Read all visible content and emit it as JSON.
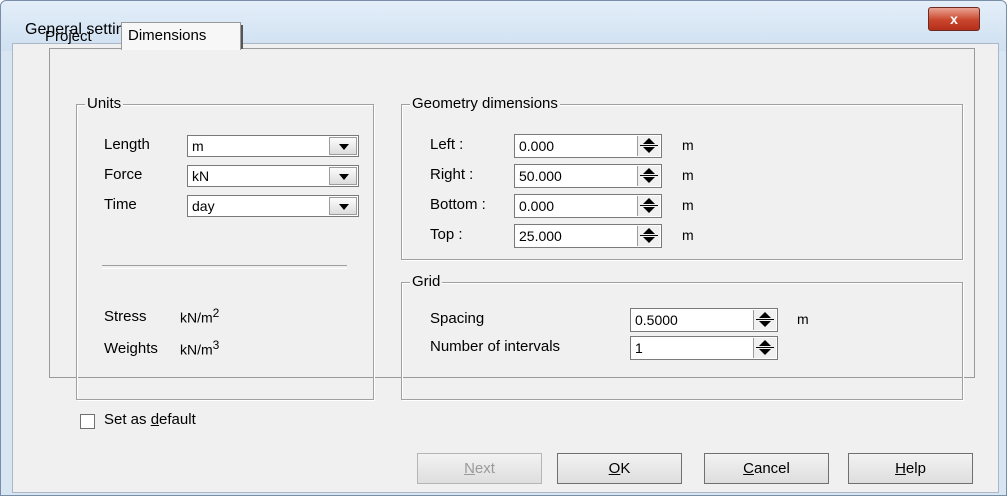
{
  "window": {
    "title": "General settings",
    "close_label": "x"
  },
  "tabs": [
    {
      "label": "Project"
    },
    {
      "label": "Dimensions"
    }
  ],
  "units": {
    "group_label": "Units",
    "length_label": "Length",
    "length_value": "m",
    "force_label": "Force",
    "force_value": "kN",
    "time_label": "Time",
    "time_value": "day",
    "stress_label": "Stress",
    "stress_unit": "kN/m",
    "stress_exp": "2",
    "weights_label": "Weights",
    "weights_unit": "kN/m",
    "weights_exp": "3"
  },
  "geometry": {
    "group_label": "Geometry dimensions",
    "left_label": "Left :",
    "left_value": "0.000",
    "right_label": "Right :",
    "right_value": "50.000",
    "bottom_label": "Bottom :",
    "bottom_value": "0.000",
    "top_label": "Top :",
    "top_value": "25.000",
    "unit": "m"
  },
  "grid": {
    "group_label": "Grid",
    "spacing_label": "Spacing",
    "spacing_value": "0.5000",
    "spacing_unit": "m",
    "intervals_label": "Number of intervals",
    "intervals_value": "1"
  },
  "footer": {
    "set_default_prefix": "Set as ",
    "set_default_key": "d",
    "set_default_suffix": "efault",
    "next_key": "N",
    "next_rest": "ext",
    "ok_key": "O",
    "ok_rest": "K",
    "cancel_key": "C",
    "cancel_rest": "ancel",
    "help_key": "H",
    "help_rest": "elp"
  }
}
